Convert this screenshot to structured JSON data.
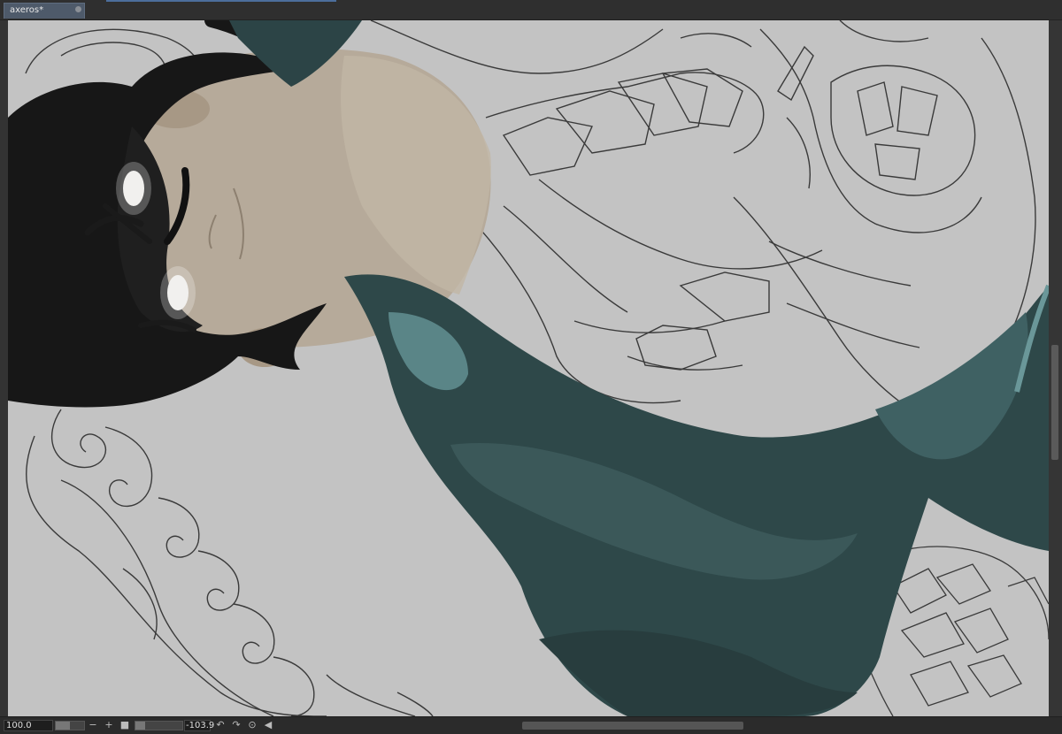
{
  "document_tab": {
    "title": "axeros*"
  },
  "status_bar": {
    "zoom_value": "100.0",
    "rotation_value": "-103.9"
  },
  "icons": {
    "zoom_out": "minus-icon",
    "zoom_in": "plus-icon",
    "fit": "square-icon",
    "rotate_left": "rotate-left-icon",
    "rotate_right": "rotate-right-icon",
    "reset_rotation": "reset-icon"
  },
  "colors": {
    "canvas_bg": "#c3c3c3",
    "cloth_teal": "#2f4a4c",
    "cloth_highlight": "#5f8c8e",
    "hair": "#161616",
    "skin": "#b7ab9b",
    "lineart": "#333333",
    "tab_active": "#4e5a6a"
  }
}
